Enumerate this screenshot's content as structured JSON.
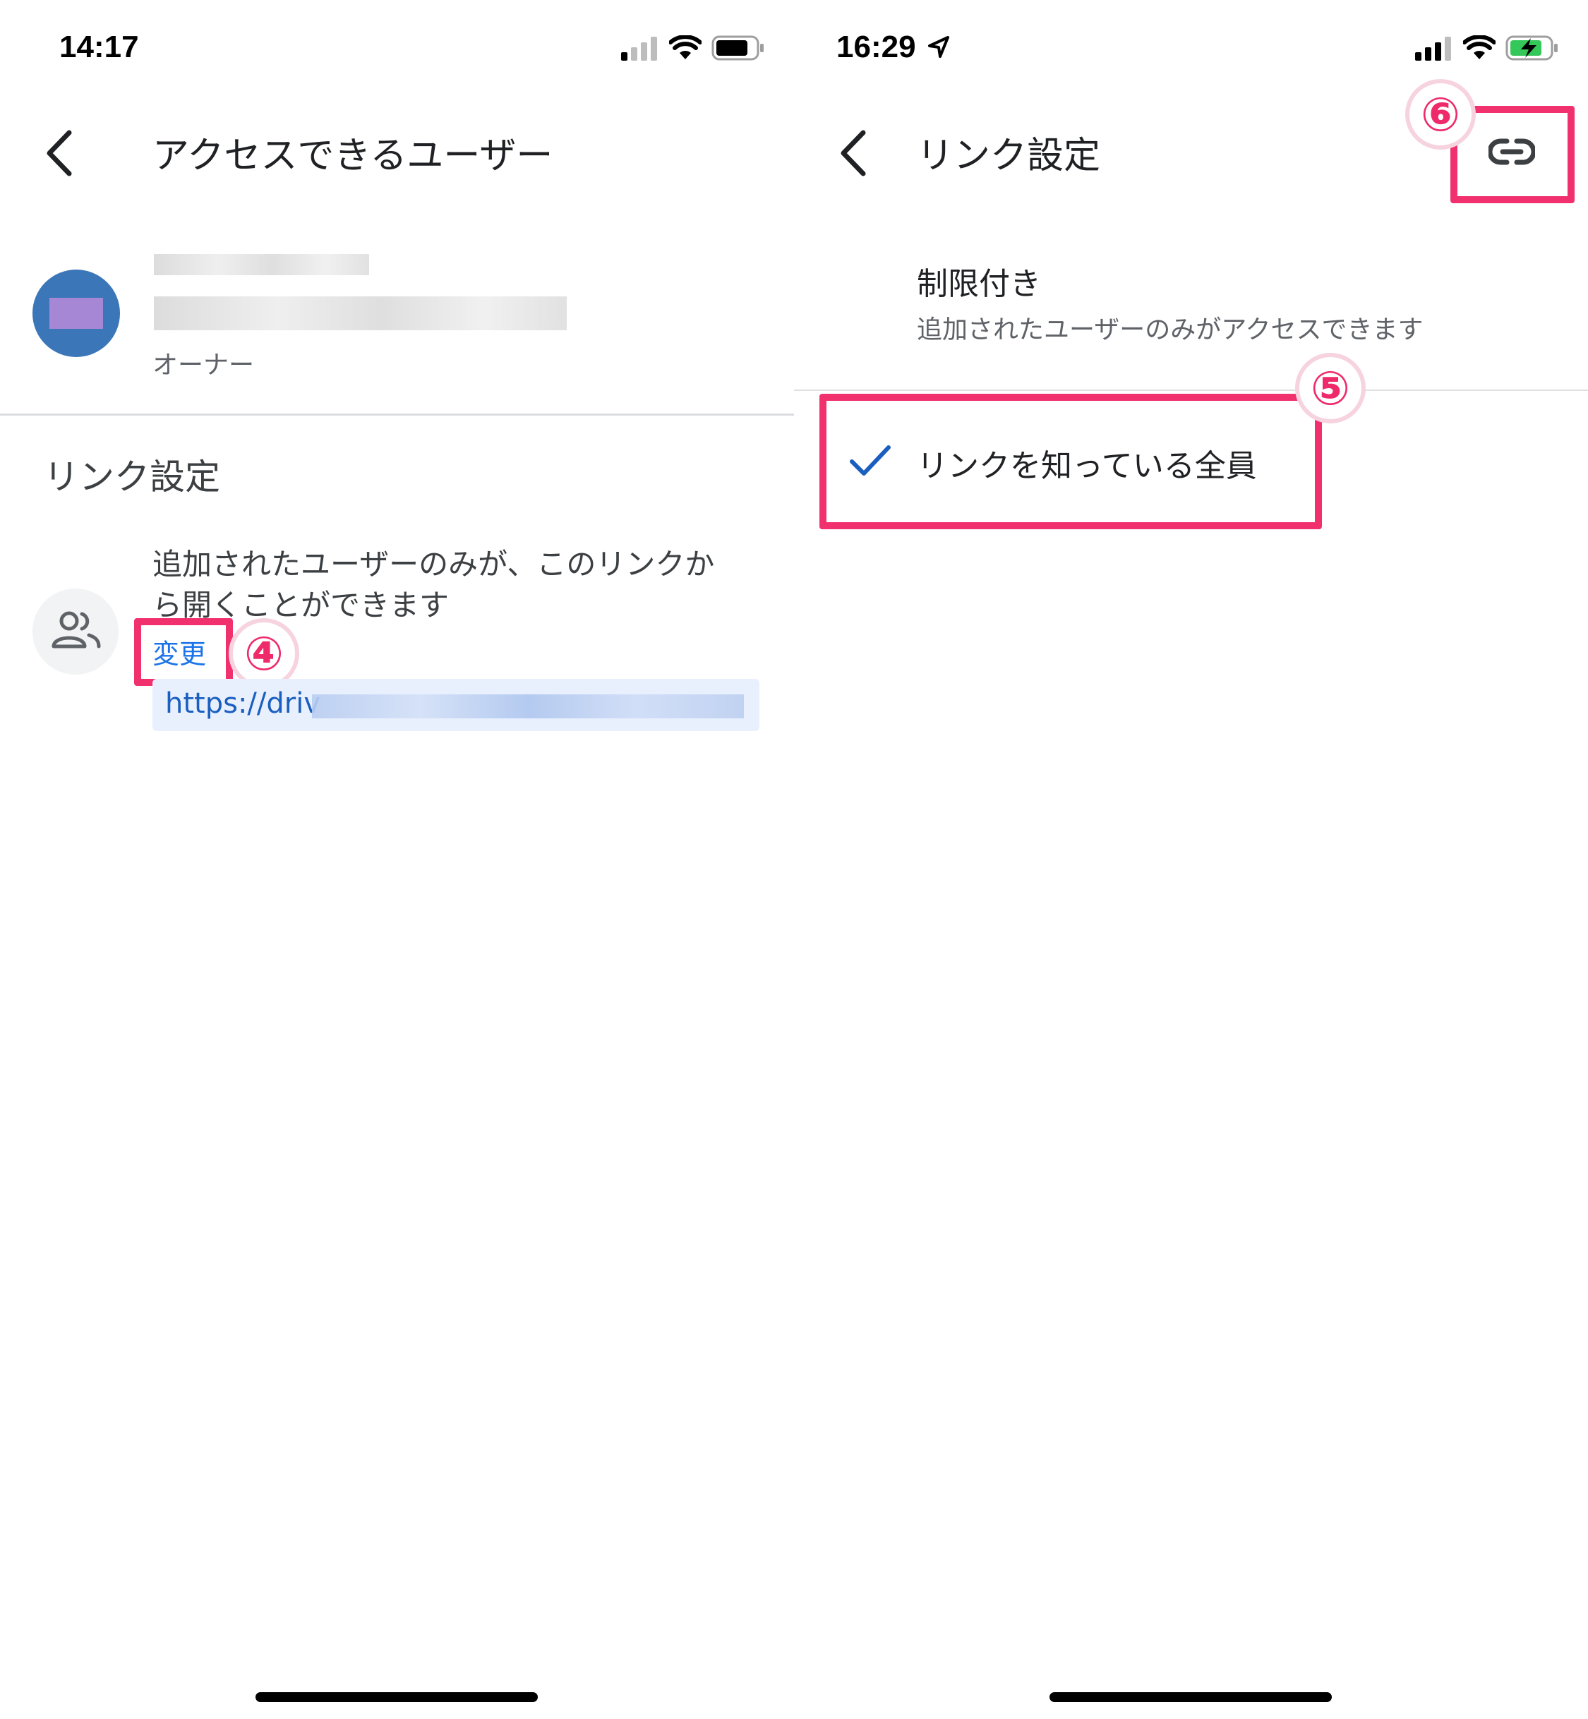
{
  "left": {
    "status": {
      "time": "14:17"
    },
    "header": {
      "title": "アクセスできるユーザー"
    },
    "owner": {
      "role": "オーナー"
    },
    "link_section": {
      "heading": "リンク設定",
      "description_line1": "追加されたユーザーのみが、このリンクか",
      "description_line2": "ら開くことができます",
      "change_label": "変更",
      "url_visible": "https://driv"
    },
    "annotation": "④"
  },
  "right": {
    "status": {
      "time": "16:29"
    },
    "header": {
      "title": "リンク設定"
    },
    "options": [
      {
        "title": "制限付き",
        "subtitle": "追加されたユーザーのみがアクセスできます",
        "selected": false
      },
      {
        "title": "リンクを知っている全員",
        "selected": true
      }
    ],
    "annotations": {
      "option": "⑤",
      "link_icon": "⑥"
    }
  },
  "colors": {
    "highlight": "#f1306e",
    "link": "#1a5fbf",
    "check": "#1a5fbf",
    "avatar": "#3b76b9",
    "battery_charging": "#34c759"
  },
  "icons": [
    "back-chevron-icon",
    "people-icon",
    "link-icon",
    "check-icon",
    "wifi-icon",
    "cellular-signal-icon",
    "battery-icon",
    "location-arrow-icon"
  ]
}
